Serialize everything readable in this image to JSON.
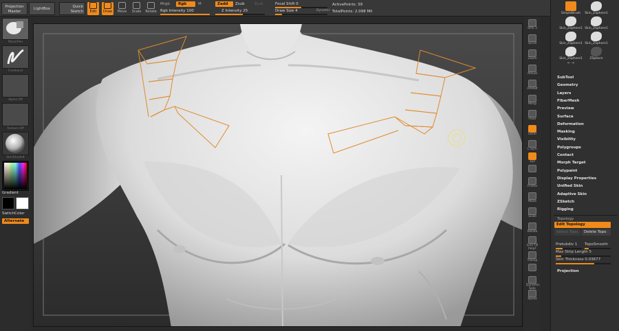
{
  "topbar": {
    "projection_master": "Projection Master",
    "lightbox": "LightBox",
    "quick_sketch": "Quick Sketch",
    "tools": [
      {
        "label": "Edit",
        "on": true
      },
      {
        "label": "Draw",
        "on": true
      },
      {
        "label": "Move",
        "on": false
      },
      {
        "label": "Scale",
        "on": false
      },
      {
        "label": "Rotate",
        "on": false
      }
    ],
    "mrgb": "Mrgb",
    "rgb": "Rgb",
    "m": "M",
    "rgb_intensity_label": "Rgb Intensity",
    "rgb_intensity": "100",
    "zadd": "Zadd",
    "zsub": "Zsub",
    "zcut": "Zcut",
    "z_intensity_label": "Z Intensity",
    "z_intensity": "25",
    "focal_shift_label": "Focal Shift",
    "focal_shift": "0",
    "draw_size_label": "Draw Size",
    "draw_size": "4",
    "dynamic": "Dynamic",
    "active_points_label": "ActivePoints:",
    "active_points": "39",
    "total_points_label": "TotalPoints:",
    "total_points": "2.098 Mil"
  },
  "left": {
    "brush_label": "Mask/Pen",
    "stroke_label": "Freehand",
    "alpha_label": "Alpha Off",
    "texture_label": "Texture Off",
    "material_label": "SkinShade4",
    "gradient": "Gradient",
    "switch_color": "SwitchColor",
    "alternate": "Alternate"
  },
  "right_shelf": [
    {
      "label": "SPix 3",
      "name": "spix"
    },
    {
      "label": "Scroll",
      "name": "scroll"
    },
    {
      "label": "Zoom",
      "name": "zoom"
    },
    {
      "label": "Actual",
      "name": "actual"
    },
    {
      "label": "AAHalf",
      "name": "aahalf"
    },
    {
      "label": "Persp",
      "name": "persp"
    },
    {
      "label": "Floor",
      "name": "floor"
    },
    {
      "label": "Local",
      "name": "local",
      "on": true
    },
    {
      "label": "L.Sym",
      "name": "lsym"
    },
    {
      "label": "xyz",
      "name": "xyz",
      "on": true
    },
    {
      "label": "",
      "name": "rot-a"
    },
    {
      "label": "Frame",
      "name": "frame"
    },
    {
      "label": "Move",
      "name": "move"
    },
    {
      "label": "Scale",
      "name": "scale"
    },
    {
      "label": "Rotate",
      "name": "rotate"
    },
    {
      "label": "Line Fill PolyF",
      "name": "polyf"
    },
    {
      "label": "Transp",
      "name": "transp"
    },
    {
      "label": "",
      "name": "ghost"
    },
    {
      "label": "Dynamic Solo",
      "name": "solo"
    },
    {
      "label": "Xpose",
      "name": "xpose"
    }
  ],
  "right_panel": {
    "brushes": [
      "SimpleBrush",
      "Skin_ZSphere1",
      "Skin_ZSphere1",
      "Skin_ZSphere1",
      "Skin_ZSphere1",
      "Skin_ZSphere1",
      "Skin_ZSphere1",
      "ZSphere"
    ],
    "arrows": "← →",
    "menus": [
      "SubTool",
      "Geometry",
      "Layers",
      "FiberMesh",
      "Preview",
      "Surface",
      "Deformation",
      "Masking",
      "Visibility",
      "Polygroups",
      "Contact",
      "Morph Target",
      "Polypaint",
      "Display Properties",
      "Unified Skin",
      "Adaptive Skin",
      "ZSketch",
      "Rigging"
    ],
    "topology_header": "Topology",
    "edit_topology": "Edit Topology",
    "select_topo": "Select Topo",
    "delete_topo": "Delete Topo",
    "pretubdiv_label": "Pretubdiv",
    "pretubdiv": "1",
    "topo_smooth": "TopoSmooth",
    "max_strip_label": "Max Strip Length",
    "max_strip": "5",
    "skin_thickness_label": "Skin Thickness",
    "skin_thickness": "0.03677",
    "projection": "Projection"
  },
  "colors": {
    "accent": "#f08a1b",
    "topology_lines": "#e0892c",
    "cursor": "#e8e080"
  }
}
